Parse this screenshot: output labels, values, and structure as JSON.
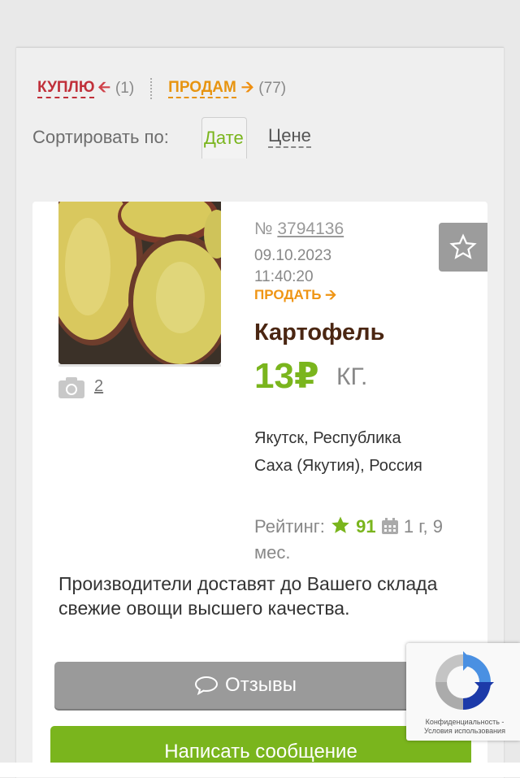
{
  "filters": {
    "buy_label": "КУПЛЮ",
    "buy_count": "(1)",
    "sell_label": "ПРОДАМ",
    "sell_count": "(77)"
  },
  "sort": {
    "label": "Сортировать по:",
    "by_date": "Дате",
    "by_price": "Цене"
  },
  "listing": {
    "number_prefix": "№",
    "number": "3794136",
    "date": "09.10.2023",
    "time": "11:40:20",
    "type": "ПРОДАТЬ",
    "title": "Картофель",
    "price": "13₽",
    "unit": "КГ.",
    "location": "Якутск, Республика Саха (Якутия), Россия",
    "rating_label": "Рейтинг:",
    "rating_value": "91",
    "age": "1 г, 9 мес.",
    "photo_count": "2",
    "description": "Производители доставят до Вашего склада свежие овощи высшего качества."
  },
  "buttons": {
    "reviews": "Отзывы",
    "write_message": "Написать сообщение"
  },
  "recaptcha": {
    "text": "Конфиденциальность - Условия использования"
  },
  "colors": {
    "green": "#7ab51d",
    "orange": "#ef9514",
    "red": "#c0303a",
    "brown": "#4a2612"
  }
}
